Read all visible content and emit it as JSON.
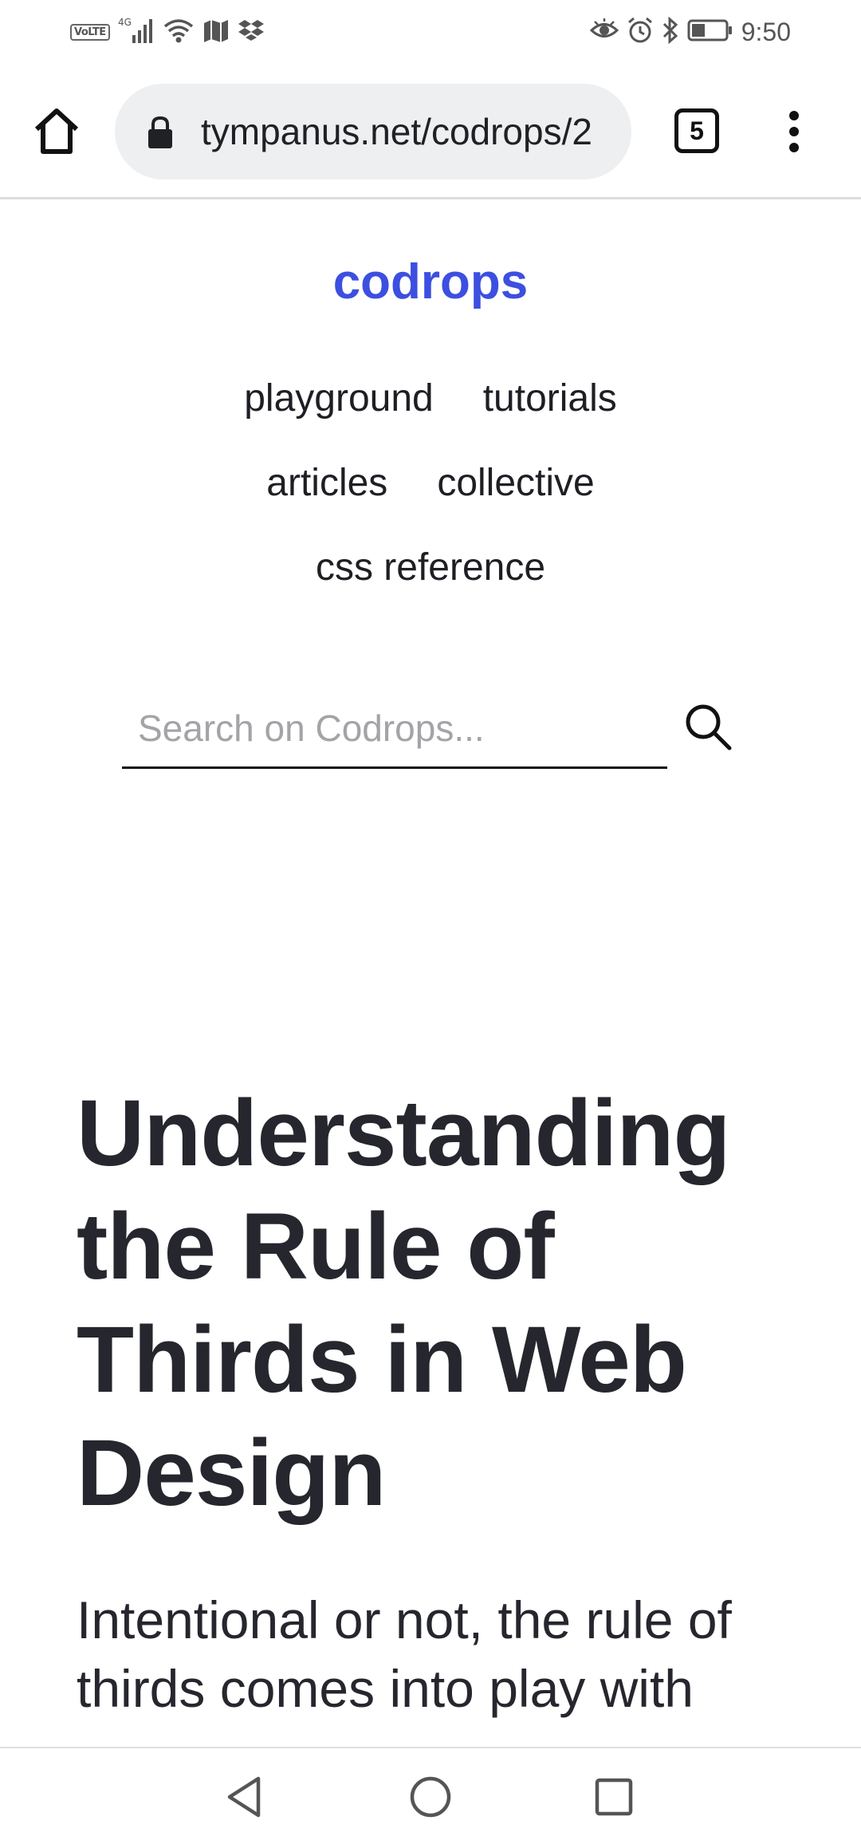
{
  "status_bar": {
    "volte": "VoLTE",
    "network": "4G",
    "time": "9:50",
    "left_icons": [
      "volte-icon",
      "signal-icon",
      "wifi-icon",
      "maps-icon",
      "dropbox-icon"
    ],
    "right_icons": [
      "eye-comfort-icon",
      "alarm-icon",
      "bluetooth-icon",
      "battery-icon"
    ]
  },
  "browser": {
    "url": "tympanus.net/codrops/2",
    "tab_count": "5"
  },
  "site": {
    "logo": "codrops",
    "nav": {
      "playground": "playground",
      "tutorials": "tutorials",
      "articles": "articles",
      "collective": "collective",
      "css_reference": "css reference"
    },
    "search": {
      "placeholder": "Search on Codrops..."
    }
  },
  "article": {
    "title": "Understanding the Rule of Thirds in Web Design",
    "intro": "Intentional or not, the rule of thirds comes into play with"
  },
  "colors": {
    "brand": "#3c4fe0",
    "text": "#26262e",
    "url_pill": "#eeeff1"
  }
}
